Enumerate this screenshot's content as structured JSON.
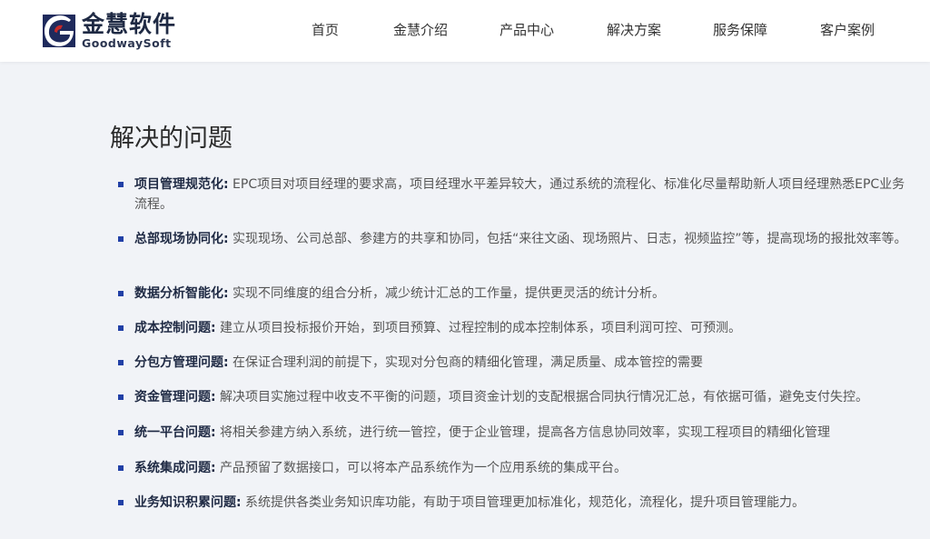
{
  "brand": {
    "name_cn": "金慧软件",
    "name_en": "GoodwaySoft"
  },
  "nav": {
    "items": [
      {
        "label": "首页"
      },
      {
        "label": "金慧介绍"
      },
      {
        "label": "产品中心"
      },
      {
        "label": "解决方案"
      },
      {
        "label": "服务保障"
      },
      {
        "label": "客户案例"
      }
    ]
  },
  "section": {
    "title": "解决的问题"
  },
  "issues": [
    {
      "label": "项目管理规范化:",
      "text": " EPC项目对项目经理的要求高，项目经理水平差异较大，通过系统的流程化、标准化尽量帮助新人项目经理熟悉EPC业务流程。"
    },
    {
      "label": "总部现场协同化:",
      "text": " 实现现场、公司总部、参建方的共享和协同，包括“来往文函、现场照片、日志，视频监控”等，提高现场的报批效率等。"
    },
    {
      "label": "数据分析智能化:",
      "text": " 实现不同维度的组合分析，减少统计汇总的工作量，提供更灵活的统计分析。"
    },
    {
      "label": "成本控制问题:",
      "text": " 建立从项目投标报价开始，到项目预算、过程控制的成本控制体系，项目利润可控、可预测。"
    },
    {
      "label": "分包方管理问题:",
      "text": " 在保证合理利润的前提下，实现对分包商的精细化管理，满足质量、成本管控的需要"
    },
    {
      "label": "资金管理问题:",
      "text": " 解决项目实施过程中收支不平衡的问题，项目资金计划的支配根据合同执行情况汇总，有依据可循，避免支付失控。"
    },
    {
      "label": "统一平台问题:",
      "text": " 将相关参建方纳入系统，进行统一管控，便于企业管理，提高各方信息协同效率，实现工程项目的精细化管理"
    },
    {
      "label": "系统集成问题:",
      "text": " 产品预留了数据接口，可以将本产品系统作为一个应用系统的集成平台。"
    },
    {
      "label": "业务知识积累问题:",
      "text": " 系统提供各类业务知识库功能，有助于项目管理更加标准化，规范化，流程化，提升项目管理能力。"
    }
  ]
}
